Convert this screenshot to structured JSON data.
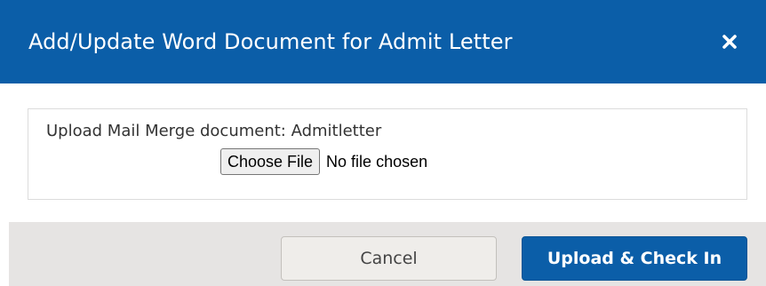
{
  "dialog": {
    "title": "Add/Update Word Document for Admit Letter",
    "close_icon": "close-icon"
  },
  "upload": {
    "label": "Upload Mail Merge document: Admitletter",
    "choose_file_label": "Choose File",
    "no_file_text": "No file chosen"
  },
  "footer": {
    "cancel_label": "Cancel",
    "upload_label": "Upload & Check In"
  },
  "colors": {
    "header_bg": "#0b5ea8",
    "primary_button": "#0b5ea8",
    "footer_bg": "#e6e4e3"
  }
}
